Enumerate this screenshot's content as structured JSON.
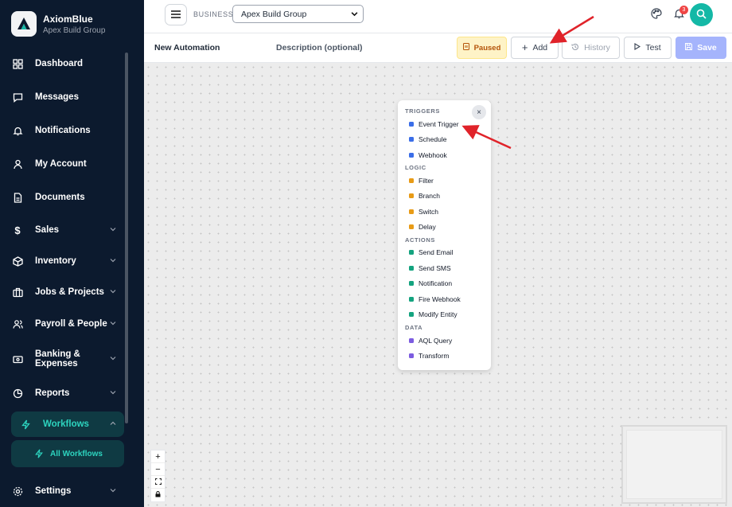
{
  "brand": {
    "name": "AxiomBlue",
    "subtitle": "Apex Build Group"
  },
  "sidebar": {
    "items": [
      {
        "label": "Dashboard",
        "icon": "grid-icon"
      },
      {
        "label": "Messages",
        "icon": "chat-icon"
      },
      {
        "label": "Notifications",
        "icon": "bell-icon"
      },
      {
        "label": "My Account",
        "icon": "user-icon"
      },
      {
        "label": "Documents",
        "icon": "document-icon"
      },
      {
        "label": "Sales",
        "icon": "dollar-icon"
      },
      {
        "label": "Inventory",
        "icon": "box-icon"
      },
      {
        "label": "Jobs & Projects",
        "icon": "briefcase-icon"
      },
      {
        "label": "Payroll & People",
        "icon": "people-icon"
      },
      {
        "label": "Banking &",
        "label2": "Expenses",
        "icon": "bank-icon"
      },
      {
        "label": "Reports",
        "icon": "pie-chart-icon"
      },
      {
        "label": "Workflows",
        "icon": "bolt-icon"
      },
      {
        "label": "All Workflows",
        "icon": "bolt-icon"
      },
      {
        "label": "Settings",
        "icon": "gear-icon"
      }
    ]
  },
  "topbar": {
    "business_label": "BUSINESS",
    "business_value": "Apex Build Group",
    "notification_count": "3"
  },
  "toolbar": {
    "title": "New Automation",
    "description_placeholder": "Description (optional)",
    "paused_label": "Paused",
    "add_label": "Add",
    "history_label": "History",
    "test_label": "Test",
    "save_label": "Save"
  },
  "menu": {
    "sections": [
      {
        "title": "TRIGGERS",
        "items": [
          "Event Trigger",
          "Schedule",
          "Webhook"
        ],
        "color": "#3b6ee8"
      },
      {
        "title": "LOGIC",
        "items": [
          "Filter",
          "Branch",
          "Switch",
          "Delay"
        ],
        "color": "#e89b16"
      },
      {
        "title": "ACTIONS",
        "items": [
          "Send Email",
          "Send SMS",
          "Notification",
          "Fire Webhook",
          "Modify Entity"
        ],
        "color": "#14a37f"
      },
      {
        "title": "DATA",
        "items": [
          "AQL Query",
          "Transform"
        ],
        "color": "#7c5ce0"
      }
    ],
    "close_glyph": "×"
  },
  "zoom": {
    "in": "+",
    "out": "−"
  },
  "colors": {
    "sidebar_bg": "#0c1a2e",
    "accent": "#14b8a6",
    "save": "#a5b4fc",
    "annotation": "#e0232a"
  }
}
